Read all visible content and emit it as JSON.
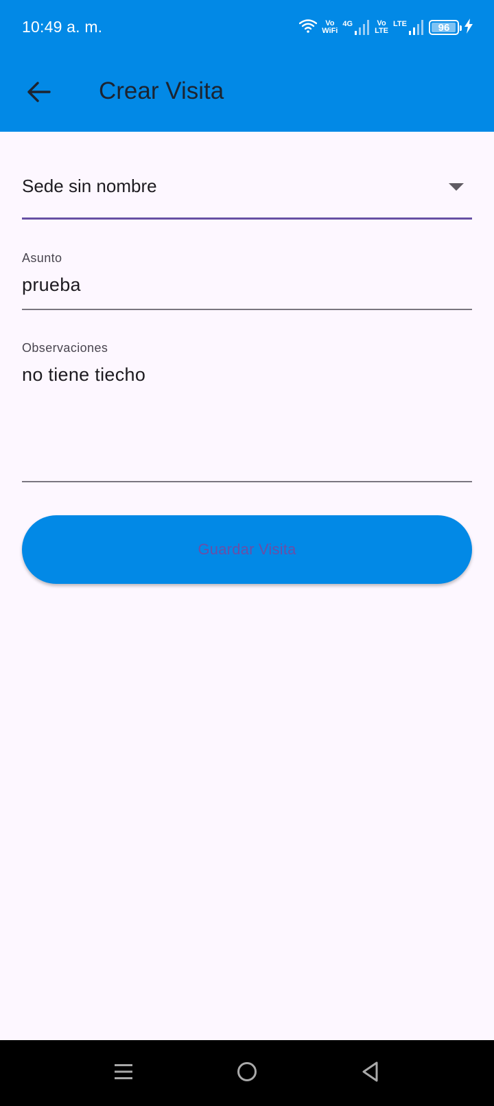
{
  "status_bar": {
    "time": "10:49 a. m.",
    "vowifi_top": "Vo",
    "vowifi_bottom": "WiFi",
    "net_4g": "4G",
    "volte_top": "Vo",
    "volte_bottom": "LTE",
    "net_lte": "LTE",
    "battery_percent": "96",
    "battery_level": 0.96
  },
  "app_bar": {
    "title": "Crear Visita",
    "back_icon": "arrow-back-icon"
  },
  "form": {
    "sede_selected": "Sede sin nombre",
    "asunto_label": "Asunto",
    "asunto_value": "prueba",
    "observaciones_label": "Observaciones",
    "observaciones_value": "no tiene tiecho",
    "save_label": "Guardar Visita"
  },
  "nav_bar": {
    "recents_icon": "menu-lines-icon",
    "home_icon": "circle-home-icon",
    "back_icon": "triangle-back-icon"
  },
  "colors": {
    "primary": "#0289e6",
    "background": "#fdf7ff",
    "dropdown_underline": "#6750a4",
    "button_text": "#6b4fa6"
  }
}
